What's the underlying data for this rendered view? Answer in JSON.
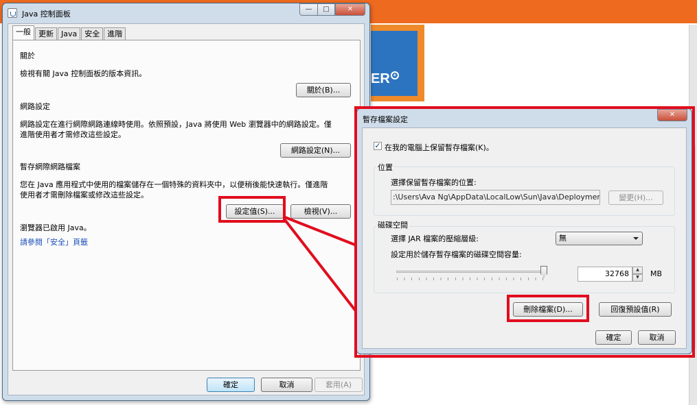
{
  "background": {
    "logo_text": "ER",
    "logo_badge": "+"
  },
  "main_window": {
    "title": "Java 控制面板",
    "caption": {
      "minimize": "—",
      "maximize": "□",
      "close": "✕"
    },
    "tabs": [
      "一般",
      "更新",
      "Java",
      "安全",
      "進階"
    ],
    "active_tab": "一般",
    "about": {
      "heading": "關於",
      "description": "檢視有關 Java 控制面板的版本資訊。",
      "button": "關於(B)..."
    },
    "network": {
      "heading": "網路設定",
      "description_line1": "網路設定在進行網際網路連線時使用。依照預設，Java 將使用 Web 瀏覽器中的網路設定。僅",
      "description_line2": "進階使用者才需修改這些設定。",
      "button": "網路設定(N)..."
    },
    "temp_files": {
      "heading": "暫存網際網路檔案",
      "description_line1": "您在 Java 應用程式中使用的檔案儲存在一個特殊的資料夾中，以便稍後能快速執行。僅進階",
      "description_line2": "使用者才需刪除檔案或修改這些設定。",
      "settings_button": "設定值(S)...",
      "view_button": "檢視(V)..."
    },
    "browser": {
      "status": "瀏覽器已啟用 Java。",
      "link": "請參閱「安全」頁籤"
    },
    "footer": {
      "ok": "確定",
      "cancel": "取消",
      "apply": "套用(A)"
    }
  },
  "cache_dialog": {
    "title": "暫存檔案設定",
    "close": "✕",
    "keep_files_checkbox": "在我的電腦上保留暫存檔案(K)。",
    "keep_files_checked": true,
    "check_mark": "✓",
    "location": {
      "legend": "位置",
      "label": "選擇保留暫存檔案的位置:",
      "path": ":\\Users\\Ava Ng\\AppData\\LocalLow\\Sun\\Java\\Deployment\\cache",
      "change_button": "變更(H)..."
    },
    "disk_space": {
      "legend": "磁碟空間",
      "compression_label": "選擇 JAR 檔案的壓縮層級:",
      "compression_value": "無",
      "amount_label": "設定用於儲存暫存檔案的磁碟空間容量:",
      "amount_value": "32768",
      "spin_up": "▲",
      "spin_down": "▼",
      "unit": "MB"
    },
    "delete_files_button": "刪除檔案(D)...",
    "restore_defaults_button": "回復預設值(R)",
    "ok": "確定",
    "cancel": "取消"
  },
  "annotation": {
    "highlight_color": "#e10d1e"
  }
}
